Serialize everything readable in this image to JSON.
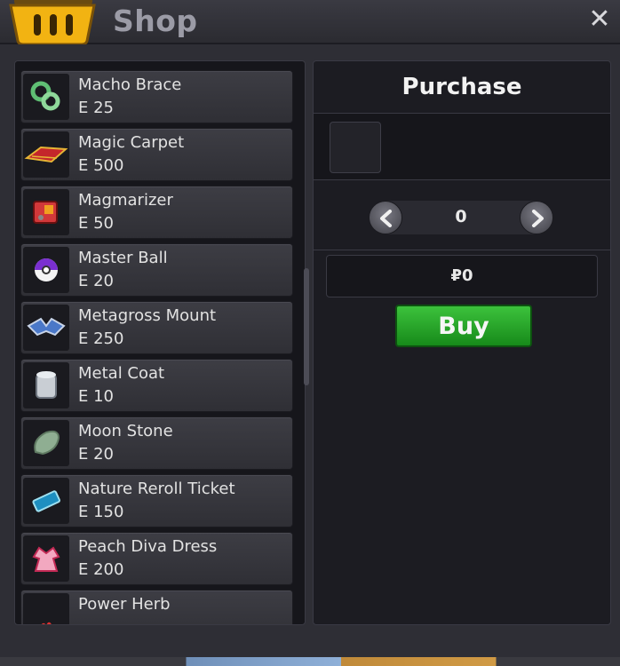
{
  "window": {
    "title": "Shop",
    "close_glyph": "✕"
  },
  "items": [
    {
      "name": "Macho Brace",
      "price": "25",
      "icon": "macho-brace-icon"
    },
    {
      "name": "Magic Carpet",
      "price": "500",
      "icon": "magic-carpet-icon"
    },
    {
      "name": "Magmarizer",
      "price": "50",
      "icon": "magmarizer-icon"
    },
    {
      "name": "Master Ball",
      "price": "20",
      "icon": "master-ball-icon"
    },
    {
      "name": "Metagross Mount",
      "price": "250",
      "icon": "metagross-mount-icon"
    },
    {
      "name": "Metal Coat",
      "price": "10",
      "icon": "metal-coat-icon"
    },
    {
      "name": "Moon Stone",
      "price": "20",
      "icon": "moon-stone-icon"
    },
    {
      "name": "Nature Reroll Ticket",
      "price": "150",
      "icon": "nature-reroll-ticket-icon"
    },
    {
      "name": "Peach Diva Dress",
      "price": "200",
      "icon": "peach-diva-dress-icon"
    },
    {
      "name": "Power Herb",
      "price": "",
      "icon": "power-herb-icon"
    }
  ],
  "currency_symbol": "E",
  "purchase": {
    "title": "Purchase",
    "quantity": "0",
    "total": "₽0",
    "buy_label": "Buy"
  },
  "colors": {
    "buy": "#2ea82f",
    "panel": "#1c1c22",
    "item": "#36363d"
  }
}
